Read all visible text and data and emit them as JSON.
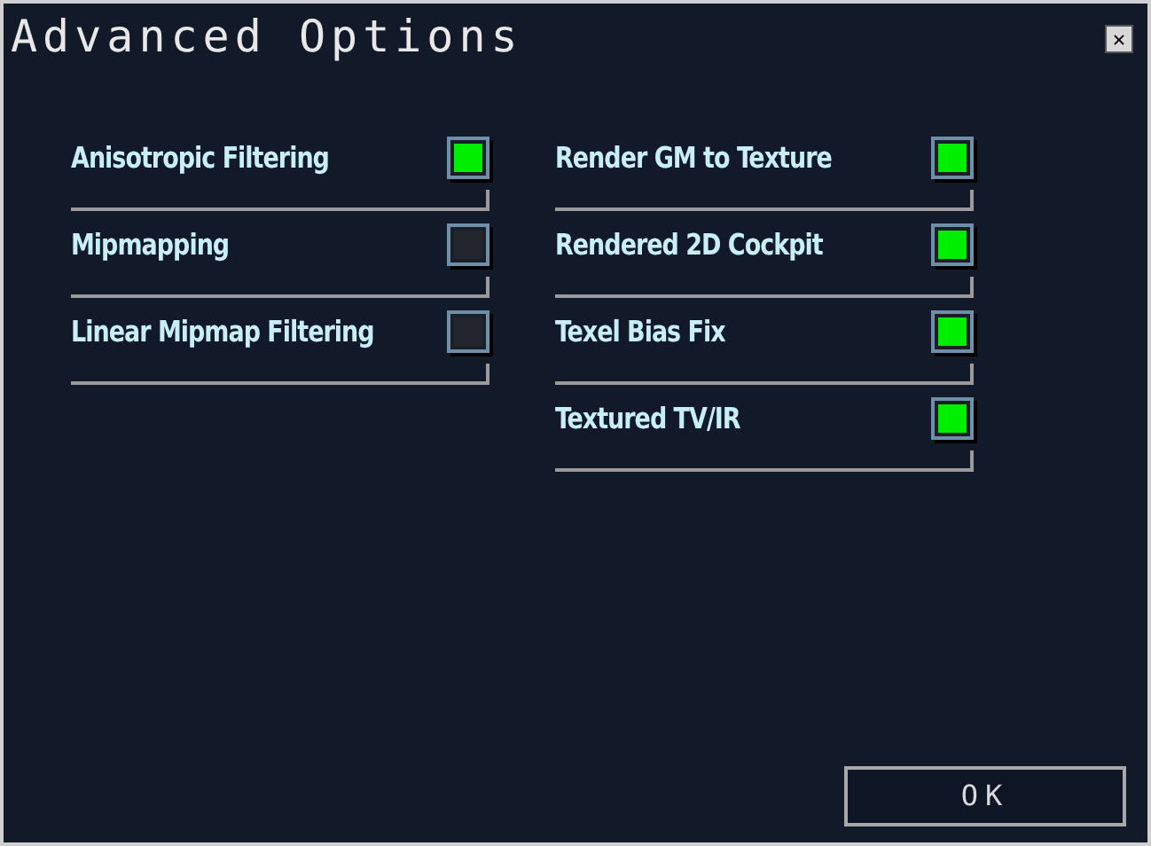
{
  "window": {
    "title": "Advanced Options",
    "close": "✕"
  },
  "columns": [
    {
      "options": [
        {
          "label": "Anisotropic Filtering",
          "checked": true
        },
        {
          "label": "Mipmapping",
          "checked": false
        },
        {
          "label": "Linear Mipmap Filtering",
          "checked": false
        }
      ]
    },
    {
      "options": [
        {
          "label": "Render GM to Texture",
          "checked": true
        },
        {
          "label": "Rendered 2D Cockpit",
          "checked": true
        },
        {
          "label": "Texel Bias Fix",
          "checked": true
        },
        {
          "label": "Textured TV/IR",
          "checked": true
        }
      ]
    }
  ],
  "ok_button": "OK"
}
